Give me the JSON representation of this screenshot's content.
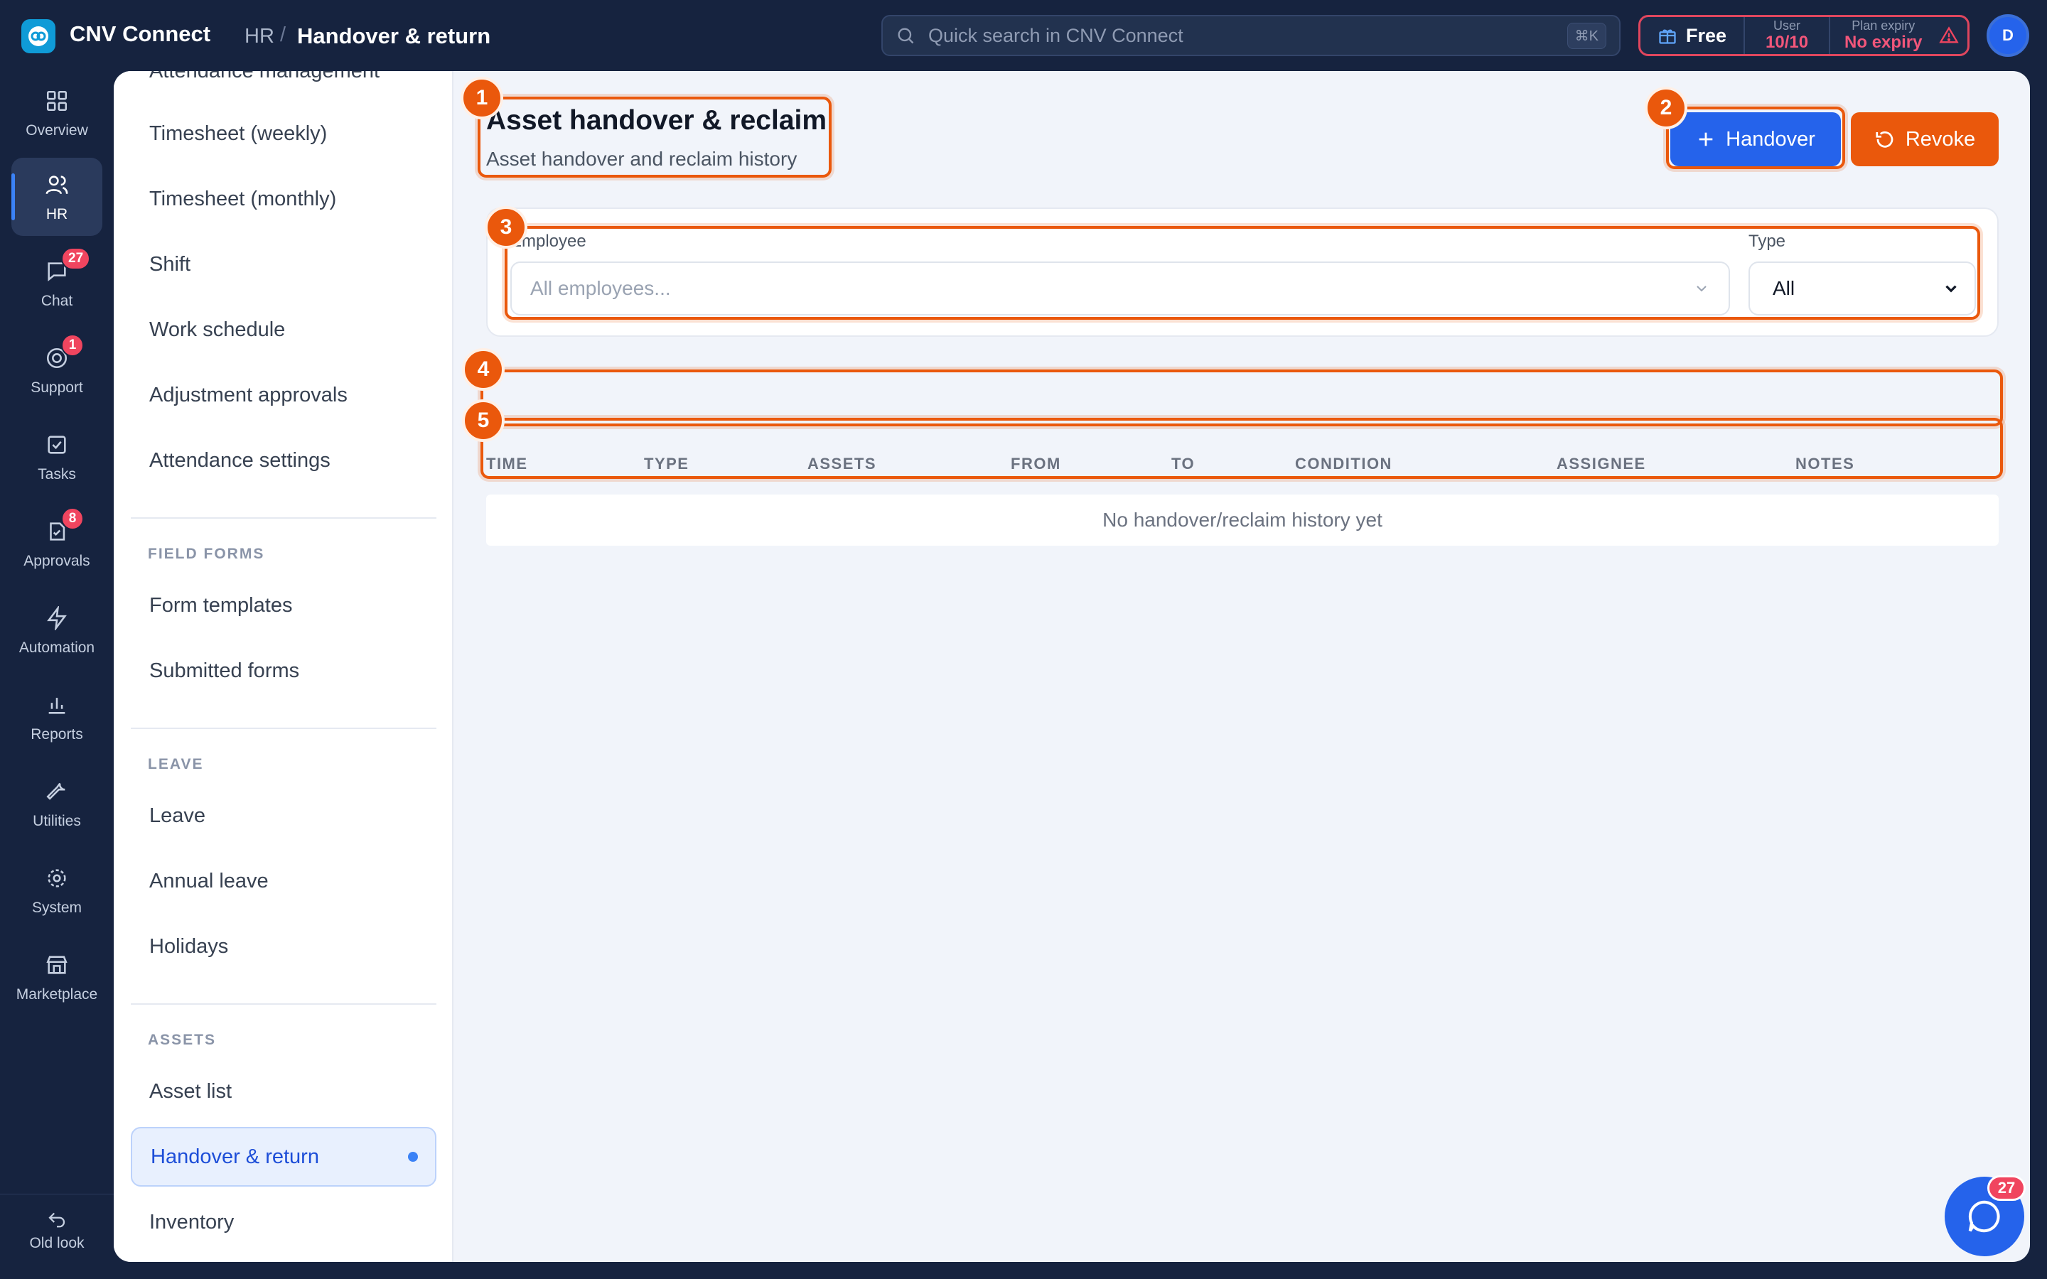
{
  "app": {
    "name": "CNV Connect"
  },
  "breadcrumb": {
    "parent": "HR",
    "separator": "/",
    "current": "Handover & return"
  },
  "search": {
    "placeholder": "Quick search in CNV Connect",
    "shortcut": "⌘K"
  },
  "plan": {
    "name": "Free",
    "user_label": "User",
    "user_value": "10/10",
    "expiry_label": "Plan expiry",
    "expiry_value": "No expiry"
  },
  "avatar": {
    "initial": "D"
  },
  "rail": {
    "items": [
      {
        "label": "Overview",
        "icon": "grid-icon",
        "badge": ""
      },
      {
        "label": "HR",
        "icon": "users-icon",
        "badge": ""
      },
      {
        "label": "Chat",
        "icon": "chat-icon",
        "badge": "27"
      },
      {
        "label": "Support",
        "icon": "support-icon",
        "badge": "1"
      },
      {
        "label": "Tasks",
        "icon": "task-check-icon",
        "badge": ""
      },
      {
        "label": "Approvals",
        "icon": "approvals-icon",
        "badge": "8"
      },
      {
        "label": "Automation",
        "icon": "lightning-icon",
        "badge": ""
      },
      {
        "label": "Reports",
        "icon": "bar-chart-icon",
        "badge": ""
      },
      {
        "label": "Utilities",
        "icon": "wrench-icon",
        "badge": ""
      },
      {
        "label": "System",
        "icon": "gear-icon",
        "badge": ""
      },
      {
        "label": "Marketplace",
        "icon": "store-icon",
        "badge": ""
      }
    ],
    "old_look": "Old look"
  },
  "subnav": {
    "partial_top": "Attendance management",
    "attendance_items": [
      "Timesheet (weekly)",
      "Timesheet (monthly)",
      "Shift",
      "Work schedule",
      "Adjustment approvals",
      "Attendance settings"
    ],
    "field_forms_title": "FIELD FORMS",
    "field_forms_items": [
      "Form templates",
      "Submitted forms"
    ],
    "leave_title": "LEAVE",
    "leave_items": [
      "Leave",
      "Annual leave",
      "Holidays"
    ],
    "assets_title": "ASSETS",
    "assets_items": [
      "Asset list",
      "Handover & return",
      "Inventory"
    ]
  },
  "page": {
    "title": "Asset handover & reclaim",
    "subtitle": "Asset handover and reclaim history",
    "handover_label": "Handover",
    "revoke_label": "Revoke"
  },
  "filters": {
    "employee_label": "Employee",
    "employee_placeholder": "All employees...",
    "type_label": "Type",
    "type_value": "All"
  },
  "table": {
    "columns": [
      "TIME",
      "TYPE",
      "ASSETS",
      "FROM",
      "TO",
      "CONDITION",
      "ASSIGNEE",
      "NOTES"
    ],
    "empty_text": "No handover/reclaim history yet"
  },
  "annotations": [
    "1",
    "2",
    "3",
    "4",
    "5"
  ],
  "chat_fab": {
    "badge": "27"
  },
  "colors": {
    "accent": "#2563eb",
    "annotation": "#ea580c",
    "badge": "#f0455f",
    "sidebar_bg": "#16233f"
  }
}
